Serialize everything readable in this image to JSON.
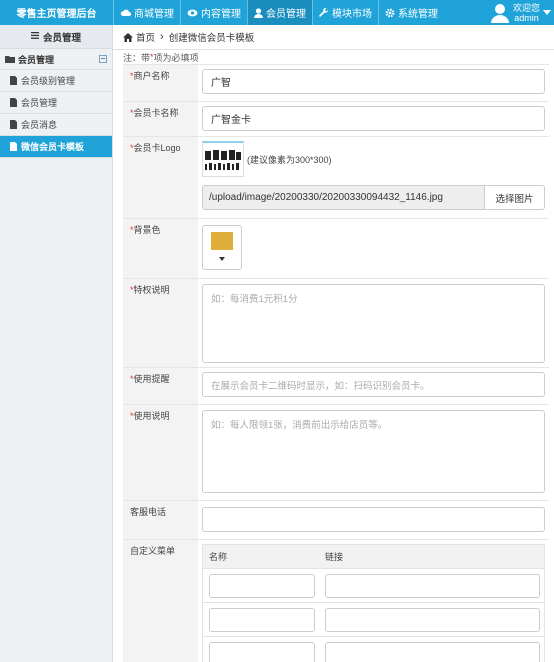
{
  "app": {
    "brand": "零售主页管理后台"
  },
  "nav": [
    {
      "label": "商城管理",
      "icon": "cloud-icon"
    },
    {
      "label": "内容管理",
      "icon": "eye-icon"
    },
    {
      "label": "会员管理",
      "icon": "user-icon",
      "active": true
    },
    {
      "label": "模块市场",
      "icon": "wrench-icon"
    },
    {
      "label": "系统管理",
      "icon": "gear-icon"
    }
  ],
  "user": {
    "greeting": "欢迎您",
    "name": "admin"
  },
  "sidebar": {
    "header": "会员管理",
    "group": "会员管理",
    "collapse_symbol": "−",
    "items": [
      {
        "label": "会员级别管理"
      },
      {
        "label": "会员管理"
      },
      {
        "label": "会员消息"
      },
      {
        "label": "微信会员卡模板",
        "active": true
      }
    ]
  },
  "breadcrumb": {
    "home": "首页",
    "separator": "›",
    "current": "创建微信会员卡模板"
  },
  "note": {
    "prefix": "注：带",
    "star": "*",
    "suffix": "项为必填项"
  },
  "form": {
    "merchant": {
      "label": "商户名称",
      "value": "广智"
    },
    "card_name": {
      "label": "会员卡名称",
      "value": "广智金卡"
    },
    "logo": {
      "label": "会员卡Logo",
      "hint": "(建议像素为300*300)",
      "path": "/upload/image/20200330/20200330094432_1146.jpg",
      "pick_label": "选择图片"
    },
    "bg_color": {
      "label": "背景色",
      "value": "#e0ae3b"
    },
    "privilege": {
      "label": "特权说明",
      "placeholder": "如：每消费1元积1分"
    },
    "reminder": {
      "label": "使用提醒",
      "placeholder": "在展示会员卡二维码时显示，如：扫码识别会员卡。"
    },
    "instructions": {
      "label": "使用说明",
      "placeholder": "如：每人限领1张，消费前出示给店员等。"
    },
    "service_phone": {
      "label": "客服电话",
      "value": ""
    },
    "custom_menu": {
      "label": "自定义菜单",
      "col_name": "名称",
      "col_link": "链接"
    }
  },
  "colors": {
    "accent": "#1fa3d8",
    "required": "#e33333"
  }
}
